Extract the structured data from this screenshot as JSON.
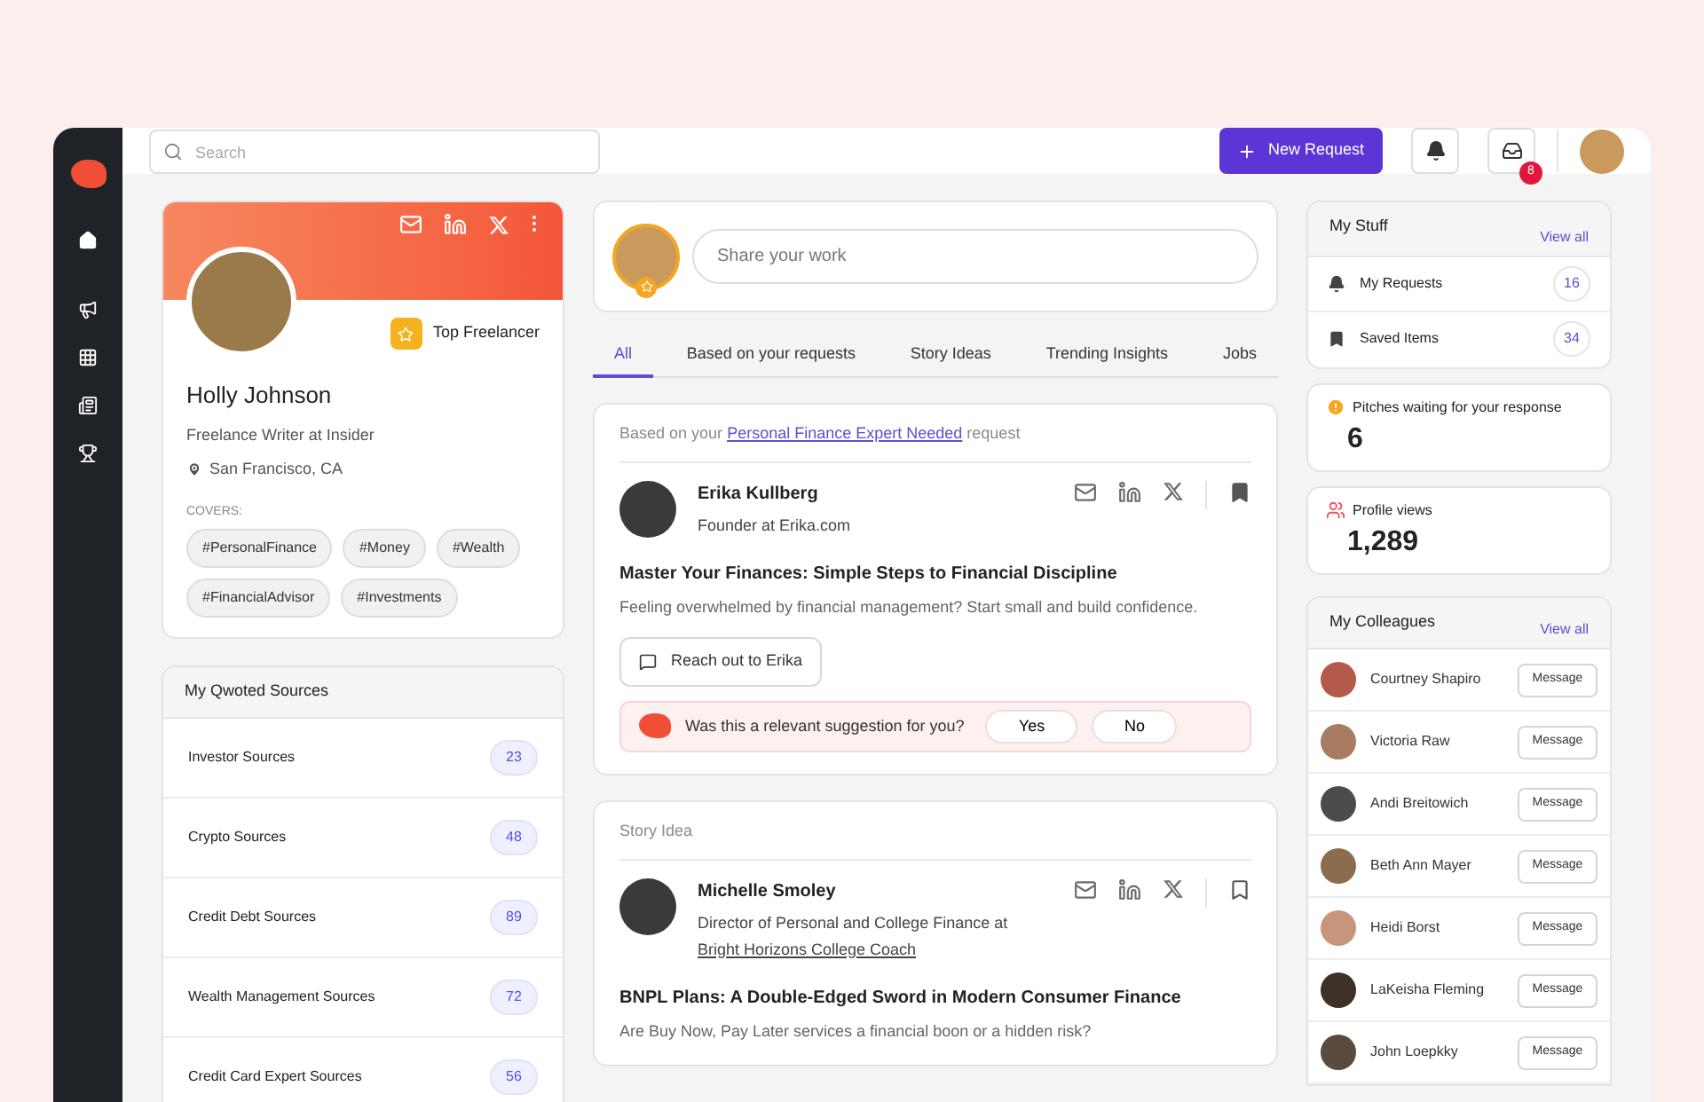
{
  "topbar": {
    "search": {
      "placeholder": "Search"
    },
    "new_request": "New Request",
    "inbox_badge": "8"
  },
  "profile": {
    "name": "Holly Johnson",
    "role": "Freelance Writer at Insider",
    "location": "San Francisco, CA",
    "badge": "Top Freelancer",
    "covers_label": "COVERS:",
    "tags": [
      "#PersonalFinance",
      "#Money",
      "#Wealth",
      "#FinancialAdvisor",
      "#Investments"
    ]
  },
  "sources": {
    "title": "My Qwoted Sources",
    "items": [
      {
        "label": "Investor Sources",
        "count": "23"
      },
      {
        "label": "Crypto Sources",
        "count": "48"
      },
      {
        "label": "Credit Debt Sources",
        "count": "89"
      },
      {
        "label": "Wealth Management Sources",
        "count": "72"
      },
      {
        "label": "Credit Card Expert Sources",
        "count": "56"
      }
    ]
  },
  "composer": {
    "placeholder": "Share your work"
  },
  "tabs": [
    {
      "label": "All",
      "selected": true
    },
    {
      "label": "Based on your requests",
      "selected": false
    },
    {
      "label": "Story Ideas",
      "selected": false
    },
    {
      "label": "Trending Insights",
      "selected": false
    },
    {
      "label": "Jobs",
      "selected": false
    }
  ],
  "feed": [
    {
      "kind": "request",
      "context_prefix": "Based on your",
      "context_link": "Personal Finance Expert Needed",
      "context_suffix": "request",
      "author": "Erika Kullberg",
      "title": "Founder at Erika.com",
      "saved": true,
      "headline": "Master Your Finances: Simple Steps to Financial Discipline",
      "summary": "Feeling overwhelmed by financial management? Start small and build confidence.",
      "action": "Reach out to Erika",
      "feedback": {
        "question": "Was this a relevant suggestion for you?",
        "yes": "Yes",
        "no": "No"
      }
    },
    {
      "kind": "story",
      "label": "Story Idea",
      "author": "Michelle Smoley",
      "title": "Director of Personal and College Finance at",
      "title_link": "Bright Horizons College Coach",
      "saved": false,
      "headline": "BNPL Plans: A Double-Edged Sword in Modern Consumer Finance",
      "summary": "Are Buy Now, Pay Later services a financial boon or a hidden risk?"
    }
  ],
  "my_stuff": {
    "title": "My Stuff",
    "view_all": "View all",
    "items": [
      {
        "kind": "bell",
        "label": "My Requests",
        "count": "16"
      },
      {
        "kind": "bookmark",
        "label": "Saved Items",
        "count": "34"
      }
    ]
  },
  "stats": [
    {
      "kind": "alert",
      "label": "Pitches waiting for your response",
      "value": "6"
    },
    {
      "kind": "people",
      "label": "Profile views",
      "value": "1,289"
    }
  ],
  "colleagues": {
    "title": "My Colleagues",
    "view_all": "View all",
    "people": [
      {
        "name": "Courtney Shapiro",
        "action": "Message"
      },
      {
        "name": "Victoria Raw",
        "action": "Message"
      },
      {
        "name": "Andi Breitowich",
        "action": "Message"
      },
      {
        "name": "Beth Ann Mayer",
        "action": "Message"
      },
      {
        "name": "Heidi Borst",
        "action": "Message"
      },
      {
        "name": "LaKeisha Fleming",
        "action": "Message"
      },
      {
        "name": "John Loepkky",
        "action": "Message"
      }
    ]
  }
}
